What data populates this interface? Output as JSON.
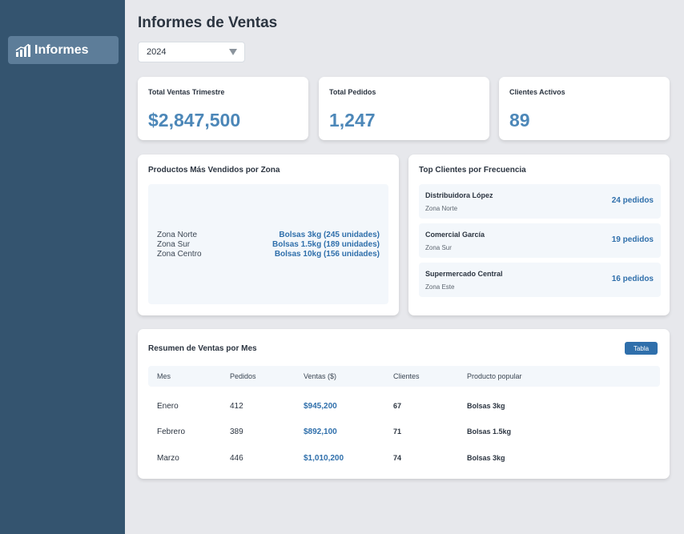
{
  "sidebar": {
    "items": [
      {
        "label": "Informes",
        "icon": "bar-chart-icon",
        "active": true
      }
    ],
    "colors": {
      "background": "#34546f",
      "active": "#5d7d99"
    }
  },
  "page": {
    "title": "Informes de Ventas"
  },
  "filter": {
    "year": "2024"
  },
  "stats": [
    {
      "label": "Total Ventas Trimestre",
      "value": "$2,847,500"
    },
    {
      "label": "Total Pedidos",
      "value": "1,247"
    },
    {
      "label": "Clientes Activos",
      "value": "89"
    }
  ],
  "zones": {
    "title": "Productos Más Vendidos por Zona",
    "rows": [
      {
        "zone": "Zona Norte",
        "product": "Bolsas 3kg (245 unidades)"
      },
      {
        "zone": "Zona Sur",
        "product": "Bolsas 1.5kg (189 unidades)"
      },
      {
        "zone": "Zona Centro",
        "product": "Bolsas 10kg (156 unidades)"
      }
    ]
  },
  "top_clients": {
    "title": "Top Clientes por Frecuencia",
    "items": [
      {
        "name": "Distribuidora López",
        "zone": "Zona Norte",
        "orders": "24 pedidos"
      },
      {
        "name": "Comercial García",
        "zone": "Zona Sur",
        "orders": "19 pedidos"
      },
      {
        "name": "Supermercado Central",
        "zone": "Zona Este",
        "orders": "16 pedidos"
      }
    ]
  },
  "monthly": {
    "title": "Resumen de Ventas por Mes",
    "view_button": "Tabla",
    "columns": [
      "Mes",
      "Pedidos",
      "Ventas ($)",
      "Clientes",
      "Producto popular"
    ],
    "rows": [
      {
        "month": "Enero",
        "orders": "412",
        "sales": "$945,200",
        "clients": "67",
        "product": "Bolsas 3kg"
      },
      {
        "month": "Febrero",
        "orders": "389",
        "sales": "$892,100",
        "clients": "71",
        "product": "Bolsas 1.5kg"
      },
      {
        "month": "Marzo",
        "orders": "446",
        "sales": "$1,010,200",
        "clients": "74",
        "product": "Bolsas 3kg"
      }
    ]
  },
  "colors": {
    "accent": "#2f6fab",
    "stat_value": "#4c87b8",
    "page_bg": "#e7e8ec"
  }
}
